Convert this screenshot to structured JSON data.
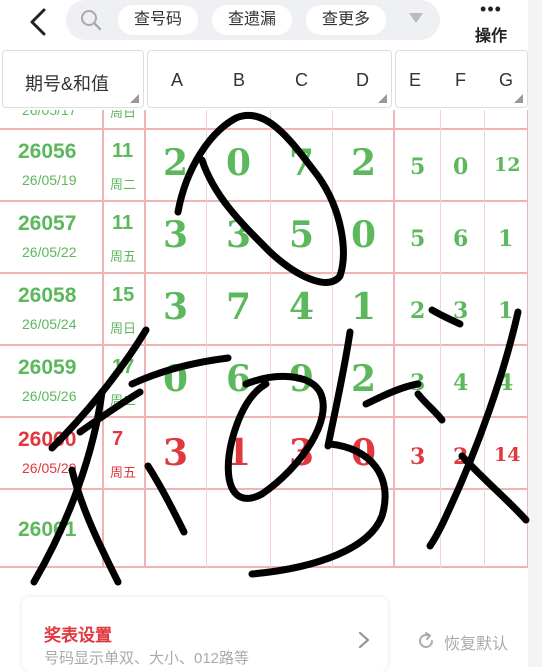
{
  "topbar": {
    "chips": [
      "查号码",
      "查遗漏",
      "查更多"
    ],
    "ops_label": "操作"
  },
  "header": {
    "issue_col": "期号&和值",
    "cols": [
      "A",
      "B",
      "C",
      "D",
      "E",
      "F",
      "G"
    ]
  },
  "rows": [
    {
      "issue": "26056",
      "date": "26/05/19",
      "sum": "11",
      "week": "周二",
      "big": [
        "2",
        "0",
        "7",
        "2"
      ],
      "small": [
        "5",
        "0",
        "12"
      ],
      "color": "green"
    },
    {
      "issue": "26057",
      "date": "26/05/22",
      "sum": "11",
      "week": "周五",
      "big": [
        "3",
        "3",
        "5",
        "0"
      ],
      "small": [
        "5",
        "6",
        "1"
      ],
      "color": "green"
    },
    {
      "issue": "26058",
      "date": "26/05/24",
      "sum": "15",
      "week": "周日",
      "big": [
        "3",
        "7",
        "4",
        "1"
      ],
      "small": [
        "2",
        "3",
        "1"
      ],
      "color": "green"
    },
    {
      "issue": "26059",
      "date": "26/05/26",
      "sum": "17",
      "week": "周二",
      "big": [
        "0",
        "6",
        "9",
        "2"
      ],
      "small": [
        "3",
        "4",
        "4"
      ],
      "color": "green"
    },
    {
      "issue": "26060",
      "date": "26/05/29",
      "sum": "7",
      "week": "周五",
      "big": [
        "3",
        "1",
        "3",
        "0"
      ],
      "small": [
        "3",
        "2",
        "14"
      ],
      "color": "red"
    },
    {
      "issue": "26061",
      "date": "",
      "sum": "",
      "week": "",
      "big": [
        "",
        "",
        "",
        ""
      ],
      "small": [
        "",
        "",
        ""
      ],
      "color": "green"
    }
  ],
  "settings": {
    "title": "奖表设置",
    "subtitle": "号码显示单双、大小、012路等"
  },
  "reset_label": "恢复默认",
  "colors": {
    "green": "#5cb85c",
    "red": "#e0383e",
    "grid": "#efb4b4"
  }
}
